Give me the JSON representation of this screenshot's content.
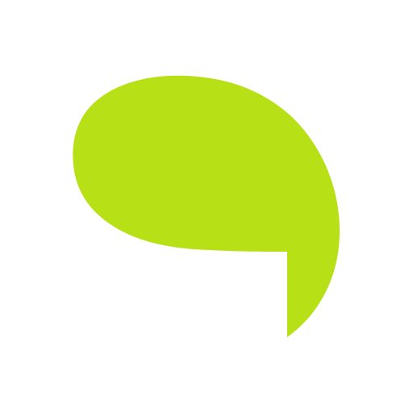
{
  "app_icon": {
    "icon": "speech-bubble-icon",
    "colors": {
      "background": "#ffffff",
      "bubble_fill": "#b8e016"
    }
  }
}
